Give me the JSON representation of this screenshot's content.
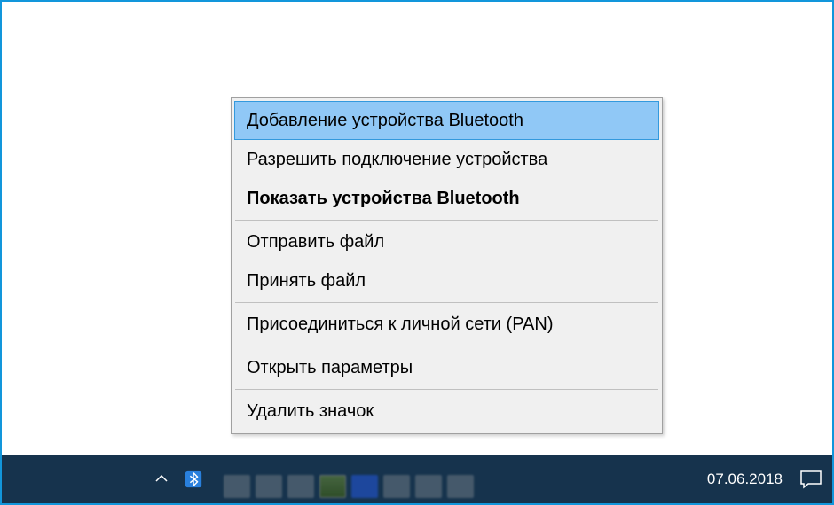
{
  "menu": {
    "items": [
      {
        "label": "Добавление устройства Bluetooth",
        "highlighted": true,
        "bold": false
      },
      {
        "label": "Разрешить подключение устройства",
        "highlighted": false,
        "bold": false
      },
      {
        "label": "Показать устройства Bluetooth",
        "highlighted": false,
        "bold": true
      },
      {
        "separator": true
      },
      {
        "label": "Отправить файл",
        "highlighted": false,
        "bold": false
      },
      {
        "label": "Принять файл",
        "highlighted": false,
        "bold": false
      },
      {
        "separator": true
      },
      {
        "label": "Присоединиться к личной сети (PAN)",
        "highlighted": false,
        "bold": false
      },
      {
        "separator": true
      },
      {
        "label": "Открыть параметры",
        "highlighted": false,
        "bold": false
      },
      {
        "separator": true
      },
      {
        "label": "Удалить значок",
        "highlighted": false,
        "bold": false
      }
    ]
  },
  "taskbar": {
    "date": "07.06.2018",
    "tray_arrow": "⌃"
  },
  "colors": {
    "highlight_bg": "#90c8f6",
    "highlight_border": "#3399dd",
    "taskbar_bg": "#16334d"
  }
}
